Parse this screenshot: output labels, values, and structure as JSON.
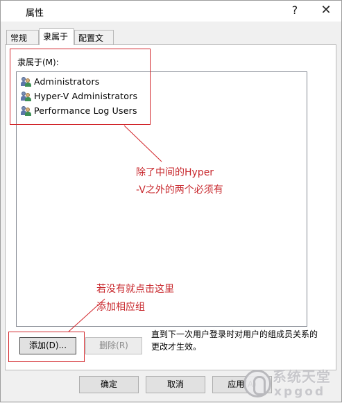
{
  "window": {
    "title": "属性",
    "help_glyph": "?",
    "close_glyph": "✕"
  },
  "tabs": [
    {
      "label": "常规",
      "active": false
    },
    {
      "label": "隶属于",
      "active": true
    },
    {
      "label": "配置文件",
      "active": false
    }
  ],
  "memberof": {
    "label": "隶属于(M):",
    "groups": [
      {
        "name": "Administrators",
        "icon": "group-icon"
      },
      {
        "name": "Hyper-V Administrators",
        "icon": "group-icon"
      },
      {
        "name": "Performance Log Users",
        "icon": "group-icon"
      }
    ],
    "add_label": "添加(D)...",
    "remove_label": "删除(R)",
    "note": "直到下一次用户登录时对用户的组成员关系的更改才生效。"
  },
  "annotations": {
    "note1_line1": "除了中间的Hyper",
    "note1_line2": "-V之外的两个必须有",
    "note2_line1": "若没有就点击这里",
    "note2_line2": "添加相应组",
    "color": "#c8282d"
  },
  "footer": {
    "ok_label": "确定",
    "cancel_label": "取消",
    "apply_label": "应用(A)"
  },
  "watermark": {
    "line1": "系统天堂",
    "line2": "xpgod"
  }
}
